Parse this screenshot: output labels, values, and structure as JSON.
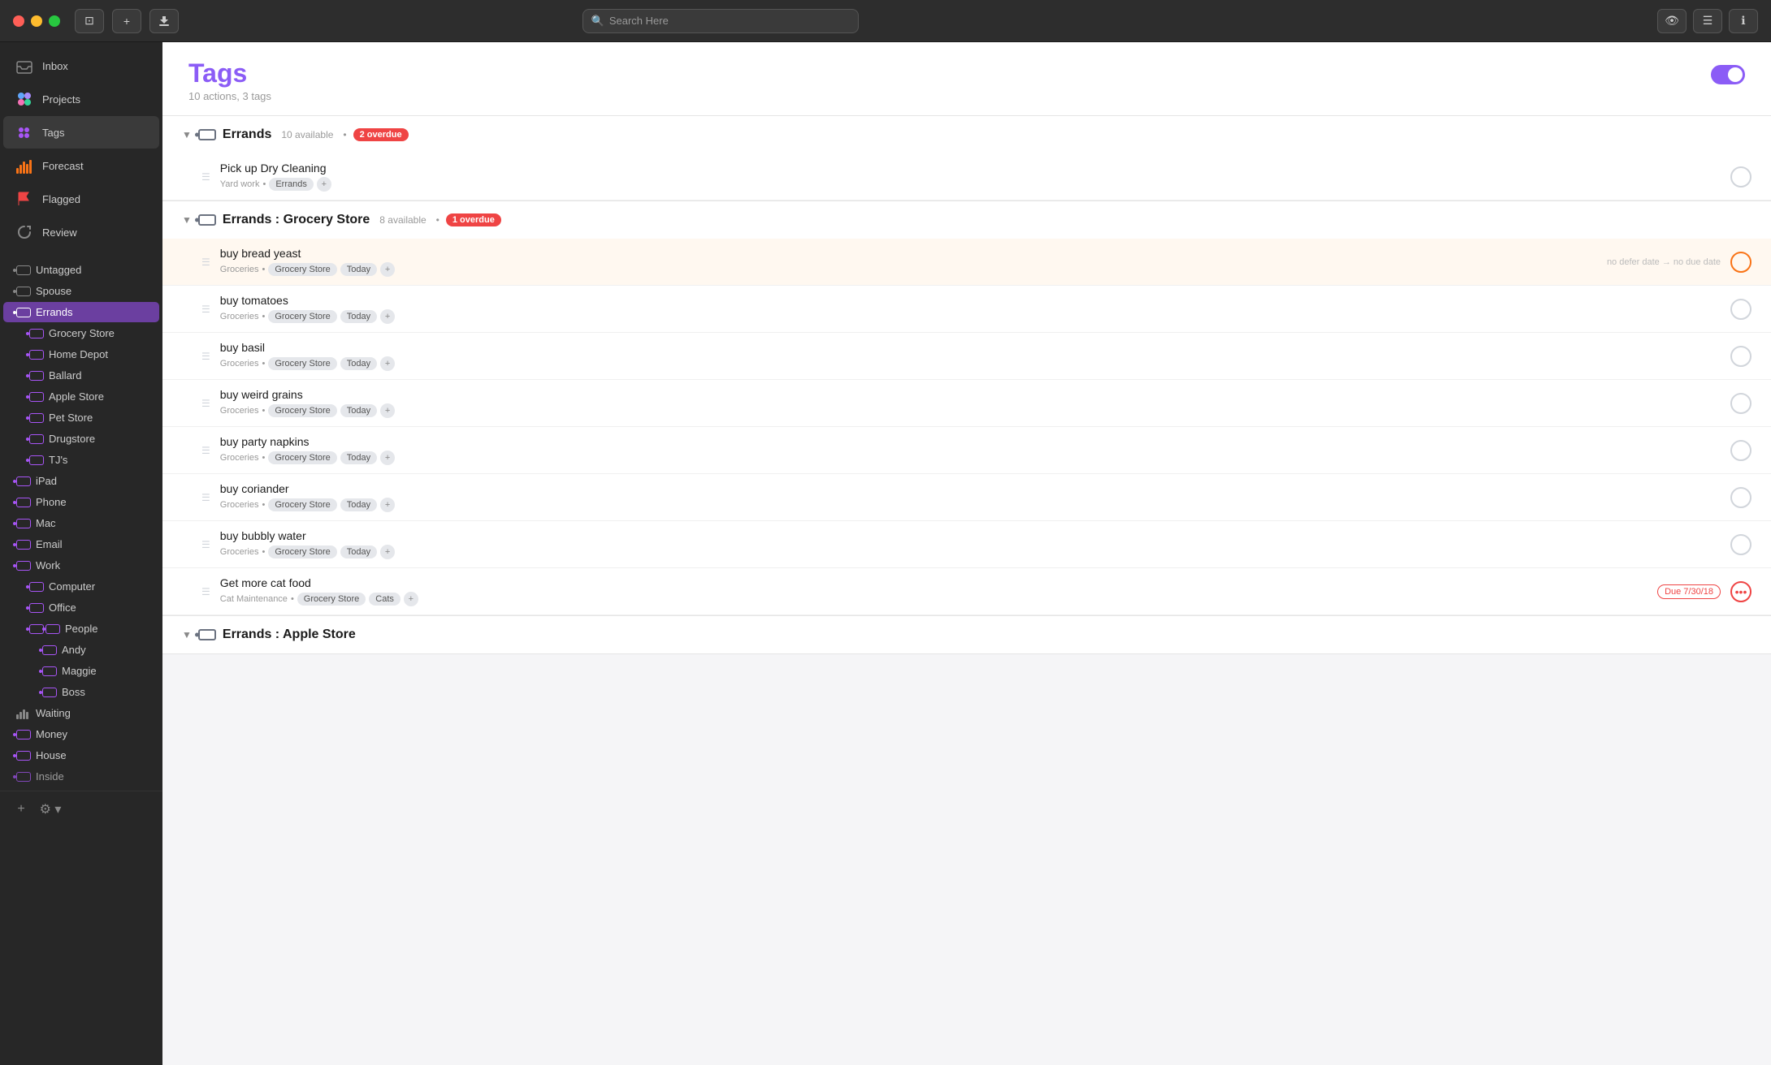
{
  "titlebar": {
    "search_placeholder": "Search Here",
    "btn_sidebar": "⊡",
    "btn_add": "+",
    "btn_download": "↓",
    "btn_eye": "👁",
    "btn_list": "☰",
    "btn_info": "ℹ"
  },
  "sidebar": {
    "nav_items": [
      {
        "id": "inbox",
        "label": "Inbox",
        "icon": "inbox"
      },
      {
        "id": "projects",
        "label": "Projects",
        "icon": "projects"
      },
      {
        "id": "tags",
        "label": "Tags",
        "icon": "tags",
        "active": true
      },
      {
        "id": "forecast",
        "label": "Forecast",
        "icon": "forecast"
      },
      {
        "id": "flagged",
        "label": "Flagged",
        "icon": "flagged"
      },
      {
        "id": "review",
        "label": "Review",
        "icon": "review"
      }
    ],
    "tag_items": [
      {
        "id": "untagged",
        "label": "Untagged",
        "level": 0
      },
      {
        "id": "spouse",
        "label": "Spouse",
        "level": 0
      },
      {
        "id": "errands",
        "label": "Errands",
        "level": 0,
        "active": true
      },
      {
        "id": "grocery-store",
        "label": "Grocery Store",
        "level": 1
      },
      {
        "id": "home-depot",
        "label": "Home Depot",
        "level": 1
      },
      {
        "id": "ballard",
        "label": "Ballard",
        "level": 1
      },
      {
        "id": "apple-store",
        "label": "Apple Store",
        "level": 1
      },
      {
        "id": "pet-store",
        "label": "Pet Store",
        "level": 1
      },
      {
        "id": "drugstore",
        "label": "Drugstore",
        "level": 1
      },
      {
        "id": "tjs",
        "label": "TJ's",
        "level": 1
      },
      {
        "id": "ipad",
        "label": "iPad",
        "level": 0
      },
      {
        "id": "phone",
        "label": "Phone",
        "level": 0
      },
      {
        "id": "mac",
        "label": "Mac",
        "level": 0
      },
      {
        "id": "email",
        "label": "Email",
        "level": 0
      },
      {
        "id": "work",
        "label": "Work",
        "level": 0
      },
      {
        "id": "computer",
        "label": "Computer",
        "level": 1
      },
      {
        "id": "office",
        "label": "Office",
        "level": 1
      },
      {
        "id": "people",
        "label": "People",
        "level": 1
      },
      {
        "id": "andy",
        "label": "Andy",
        "level": 2
      },
      {
        "id": "maggie",
        "label": "Maggie",
        "level": 2
      },
      {
        "id": "boss",
        "label": "Boss",
        "level": 2
      },
      {
        "id": "waiting",
        "label": "Waiting",
        "level": 0
      },
      {
        "id": "money",
        "label": "Money",
        "level": 0
      },
      {
        "id": "house",
        "label": "House",
        "level": 0
      },
      {
        "id": "inside",
        "label": "Inside",
        "level": 0
      }
    ],
    "footer": {
      "add": "+",
      "settings": "⚙"
    }
  },
  "content": {
    "title": "Tags",
    "subtitle": "10 actions, 3 tags",
    "sections": [
      {
        "id": "errands",
        "title": "Errands",
        "available": "10 available",
        "overdue_count": "2 overdue",
        "tasks": [
          {
            "id": "pick-up-dry-cleaning",
            "title": "Pick up Dry Cleaning",
            "project": "Yard work",
            "tags": [
              "Errands"
            ],
            "highlighted": false
          }
        ]
      },
      {
        "id": "errands-grocery",
        "title": "Errands : Grocery Store",
        "available": "8 available",
        "overdue_count": "1 overdue",
        "tasks": [
          {
            "id": "buy-bread-yeast",
            "title": "buy bread yeast",
            "project": "Groceries",
            "tags": [
              "Grocery Store",
              "Today"
            ],
            "highlighted": true,
            "right_info": "no defer date → no due date"
          },
          {
            "id": "buy-tomatoes",
            "title": "buy tomatoes",
            "project": "Groceries",
            "tags": [
              "Grocery Store",
              "Today"
            ],
            "highlighted": false
          },
          {
            "id": "buy-basil",
            "title": "buy basil",
            "project": "Groceries",
            "tags": [
              "Grocery Store",
              "Today"
            ],
            "highlighted": false
          },
          {
            "id": "buy-weird-grains",
            "title": "buy weird grains",
            "project": "Groceries",
            "tags": [
              "Grocery Store",
              "Today"
            ],
            "highlighted": false
          },
          {
            "id": "buy-party-napkins",
            "title": "buy party napkins",
            "project": "Groceries",
            "tags": [
              "Grocery Store",
              "Today"
            ],
            "highlighted": false
          },
          {
            "id": "buy-coriander",
            "title": "buy coriander",
            "project": "Groceries",
            "tags": [
              "Grocery Store",
              "Today"
            ],
            "highlighted": false
          },
          {
            "id": "buy-bubbly-water",
            "title": "buy bubbly water",
            "project": "Groceries",
            "tags": [
              "Grocery Store",
              "Today"
            ],
            "highlighted": false
          },
          {
            "id": "get-more-cat-food",
            "title": "Get more cat food",
            "project": "Cat Maintenance",
            "tags": [
              "Grocery Store",
              "Cats"
            ],
            "highlighted": false,
            "due": "Due 7/30/18",
            "is_due": true
          }
        ]
      },
      {
        "id": "errands-apple",
        "title": "Errands : Apple Store",
        "available": "",
        "overdue_count": "",
        "tasks": []
      }
    ]
  }
}
